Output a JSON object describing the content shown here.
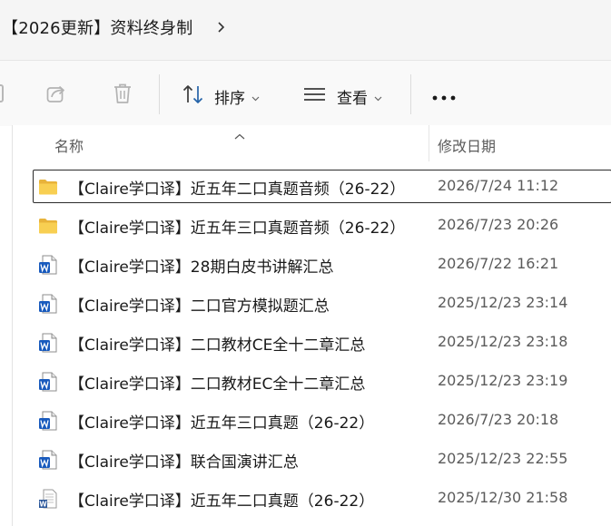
{
  "breadcrumb": {
    "path": "【2026更新】资料终身制",
    "separator_icon": "chevron-right-icon"
  },
  "toolbar": {
    "share_icon": "share-icon",
    "delete_icon": "delete-icon",
    "sort_label": "排序",
    "view_label": "查看",
    "more_icon": "more-icon"
  },
  "columns": {
    "name": "名称",
    "date_modified": "修改日期"
  },
  "files": [
    {
      "name": "【Claire学口译】近五年二口真题音频（26-22）",
      "date": "2026/7/24 11:12",
      "icon": "folder-icon"
    },
    {
      "name": "【Claire学口译】近五年三口真题音频（26-22）",
      "date": "2026/7/23 20:26",
      "icon": "folder-icon"
    },
    {
      "name": "【Claire学口译】28期白皮书讲解汇总",
      "date": "2026/7/22 16:21",
      "icon": "word-doc-icon"
    },
    {
      "name": "【Claire学口译】二口官方模拟题汇总",
      "date": "2025/12/23 23:14",
      "icon": "word-doc-icon"
    },
    {
      "name": "【Claire学口译】二口教材CE全十二章汇总",
      "date": "2025/12/23 23:18",
      "icon": "word-doc-icon"
    },
    {
      "name": "【Claire学口译】二口教材EC全十二章汇总",
      "date": "2025/12/23 23:19",
      "icon": "word-doc-icon"
    },
    {
      "name": "【Claire学口译】近五年三口真题（26-22）",
      "date": "2026/7/23 20:18",
      "icon": "word-doc-icon"
    },
    {
      "name": "【Claire学口译】联合国演讲汇总",
      "date": "2025/12/23 22:55",
      "icon": "word-doc-icon"
    },
    {
      "name": "【Claire学口译】近五年二口真题（26-22）",
      "date": "2025/12/30 21:58",
      "icon": "word-doc-legacy-icon"
    }
  ],
  "colors": {
    "folder": "#f6c644",
    "word_blue": "#185abd",
    "selection_border": "#2b2b2b"
  }
}
